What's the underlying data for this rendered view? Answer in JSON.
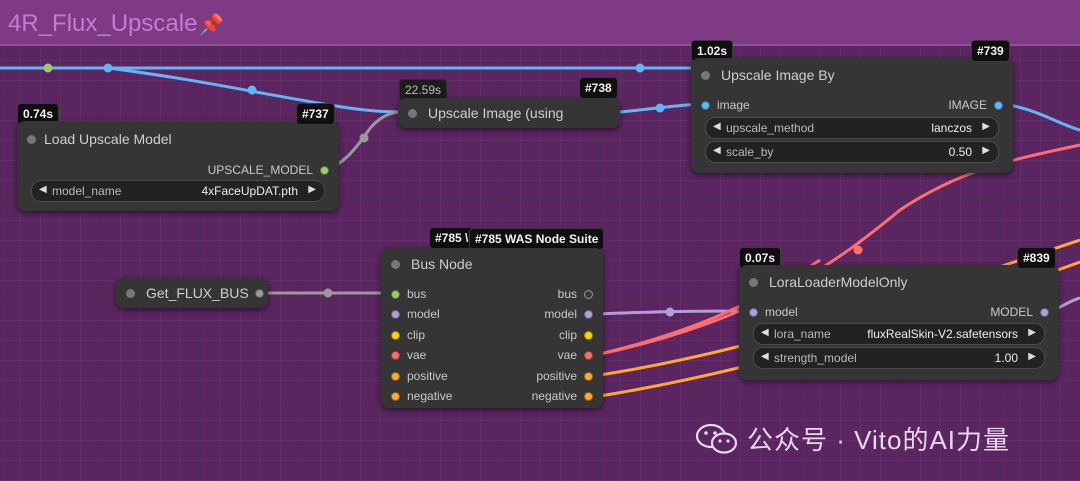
{
  "group": {
    "title": "4R_Flux_Upscale",
    "pin_icon": "📌"
  },
  "colors": {
    "image": "#64b5f6",
    "model": "#b39ddb",
    "bus": "#9ccc65",
    "clip": "#ffd500",
    "vae": "#ff6e6e",
    "conditioning": "#ffa931",
    "upscale_model": "#9ccc65"
  },
  "nodes": {
    "load_upscale": {
      "time": "0.74s",
      "id": "#737",
      "title": "Load Upscale Model",
      "output": "UPSCALE_MODEL",
      "widget": {
        "name": "model_name",
        "value": "4xFaceUpDAT.pth"
      }
    },
    "upscale_using": {
      "time": "22.59s",
      "id": "#738",
      "title": "Upscale Image (using"
    },
    "upscale_by": {
      "time": "1.02s",
      "id": "#739",
      "title": "Upscale Image By",
      "input": "image",
      "output": "IMAGE",
      "widgets": [
        {
          "name": "upscale_method",
          "value": "lanczos"
        },
        {
          "name": "scale_by",
          "value": "0.50"
        }
      ]
    },
    "get_flux_bus": {
      "title": "Get_FLUX_BUS"
    },
    "bus_node": {
      "id_partial": "#785 \\",
      "id_full": "#785 WAS Node Suite",
      "title": "Bus Node",
      "inputs": [
        "bus",
        "model",
        "clip",
        "vae",
        "positive",
        "negative"
      ],
      "outputs": [
        "bus",
        "model",
        "clip",
        "vae",
        "positive",
        "negative"
      ]
    },
    "lora": {
      "time": "0.07s",
      "id": "#839",
      "title": "LoraLoaderModelOnly",
      "input": "model",
      "output": "MODEL",
      "widgets": [
        {
          "name": "lora_name",
          "value": "fluxRealSkin-V2.safetensors"
        },
        {
          "name": "strength_model",
          "value": "1.00"
        }
      ]
    }
  },
  "watermark": {
    "text": "公众号 · Vito的AI力量",
    "icon": "wechat-icon"
  }
}
